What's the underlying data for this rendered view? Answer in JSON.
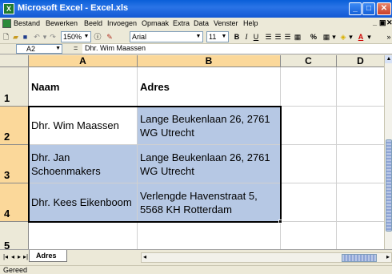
{
  "window": {
    "title": "Microsoft Excel - Excel.xls",
    "app_icon": "X",
    "colors": {
      "titlebar": "#0a5fd8",
      "selection": "#b6c8e4",
      "header_highlight": "#fbd89a"
    }
  },
  "menu": [
    "Bestand",
    "Bewerken",
    "Beeld",
    "Invoegen",
    "Opmaak",
    "Extra",
    "Data",
    "Venster",
    "Help"
  ],
  "toolbar": {
    "zoom": "150%",
    "font": "Arial",
    "font_size": "11",
    "percent": "%"
  },
  "formula_bar": {
    "cell_ref": "A2",
    "fx": "=",
    "content": "Dhr. Wim Maassen"
  },
  "columns": [
    "A",
    "B",
    "C",
    "D"
  ],
  "rows": [
    {
      "num": "1",
      "a": "Naam",
      "b": "Adres"
    },
    {
      "num": "2",
      "a": "Dhr. Wim Maassen",
      "b": "Lange Beukenlaan 26, 2761 WG  Utrecht"
    },
    {
      "num": "3",
      "a": "Dhr. Jan Schoenmakers",
      "b": "Lange Beukenlaan 26, 2761 WG  Utrecht"
    },
    {
      "num": "4",
      "a": "Dhr. Kees Eikenboom",
      "b": "Verlengde Havenstraat 5, 5568 KH  Rotterdam"
    },
    {
      "num": "5",
      "a": "",
      "b": ""
    }
  ],
  "sheet_tab": "Adres",
  "status": "Gereed"
}
